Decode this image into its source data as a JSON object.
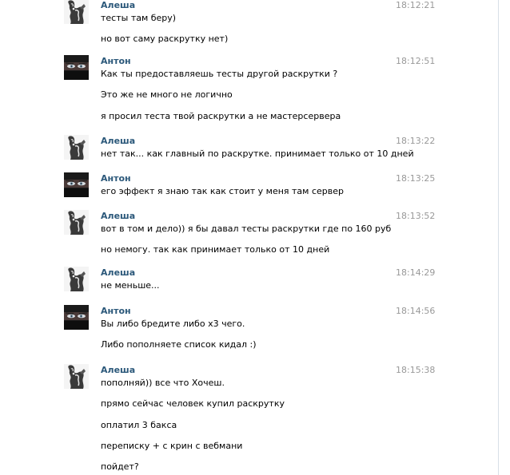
{
  "messages": [
    {
      "author": "Алеша",
      "avatar": "alesha",
      "time": "18:12:21",
      "lines": [
        "тесты там беру)",
        "но вот саму раскрутку нет)"
      ]
    },
    {
      "author": "Антон",
      "avatar": "anton",
      "time": "18:12:51",
      "lines": [
        "Как ты предоставляешь тесты другой раскрутки ?",
        "Это же не много не логично",
        "я просил теста твой раскрутки а не мастерсервера"
      ]
    },
    {
      "author": "Алеша",
      "avatar": "alesha",
      "time": "18:13:22",
      "lines": [
        "нет так... как главный по раскрутке. принимает только от 10 дней"
      ]
    },
    {
      "author": "Антон",
      "avatar": "anton",
      "time": "18:13:25",
      "lines": [
        "его эффект я знаю так как стоит у меня там сервер"
      ]
    },
    {
      "author": "Алеша",
      "avatar": "alesha",
      "time": "18:13:52",
      "lines": [
        "вот в том и дело)) я бы давал тесты раскрутки где по 160 руб",
        "но немогу. так как принимает только от 10 дней"
      ]
    },
    {
      "author": "Алеша",
      "avatar": "alesha",
      "time": "18:14:29",
      "lines": [
        "не меньше..."
      ]
    },
    {
      "author": "Антон",
      "avatar": "anton",
      "time": "18:14:56",
      "lines": [
        "Вы либо бредите либо х3 чего.",
        "Либо пополняете список кидал :)"
      ]
    },
    {
      "author": "Алеша",
      "avatar": "alesha",
      "time": "18:15:38",
      "lines": [
        "пополняй)) все что Хочеш.",
        "прямо сейчас человек купил раскрутку",
        "оплатил 3 бакса",
        "переписку + с крин с вебмани",
        "пойдет?"
      ]
    }
  ]
}
